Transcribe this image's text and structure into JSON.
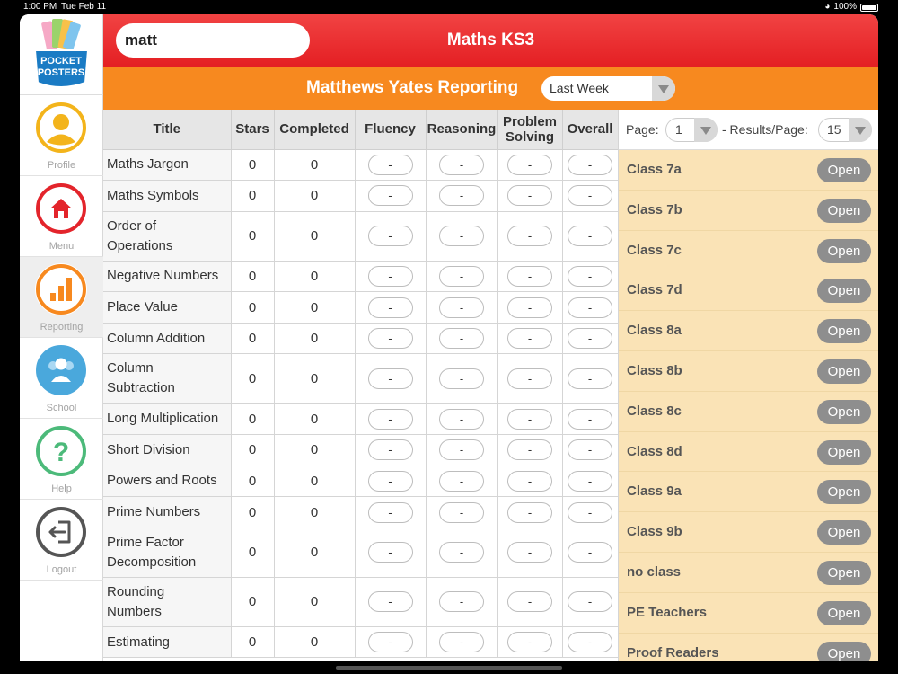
{
  "status_bar": {
    "time": "1:00 PM",
    "date": "Tue Feb 11",
    "battery": "100%"
  },
  "header": {
    "search_value": "matt",
    "title": "Maths KS3"
  },
  "subheader": {
    "title": "Matthews Yates Reporting",
    "period": "Last Week"
  },
  "logo": {
    "line1": "POCKET",
    "line2": "POSTERS"
  },
  "sidebar": {
    "items": [
      {
        "label": "Profile",
        "icon": "profile-icon",
        "color": "#f3b41b"
      },
      {
        "label": "Menu",
        "icon": "home-icon",
        "color": "#e3242b"
      },
      {
        "label": "Reporting",
        "icon": "bar-chart-icon",
        "color": "#f7891f",
        "active": true
      },
      {
        "label": "School",
        "icon": "group-icon",
        "color": "#4aa8dc"
      },
      {
        "label": "Help",
        "icon": "question-icon",
        "color": "#4cba7a"
      },
      {
        "label": "Logout",
        "icon": "logout-icon",
        "color": "#555555"
      }
    ]
  },
  "table": {
    "columns": [
      "Title",
      "Stars",
      "Completed",
      "Fluency",
      "Reasoning",
      "Problem Solving",
      "Overall"
    ],
    "rows": [
      {
        "title": "Maths Jargon",
        "stars": "0",
        "completed": "0",
        "fluency": "-",
        "reasoning": "-",
        "problem_solving": "-",
        "overall": "-"
      },
      {
        "title": "Maths Symbols",
        "stars": "0",
        "completed": "0",
        "fluency": "-",
        "reasoning": "-",
        "problem_solving": "-",
        "overall": "-"
      },
      {
        "title": "Order of Operations",
        "stars": "0",
        "completed": "0",
        "fluency": "-",
        "reasoning": "-",
        "problem_solving": "-",
        "overall": "-"
      },
      {
        "title": "Negative Numbers",
        "stars": "0",
        "completed": "0",
        "fluency": "-",
        "reasoning": "-",
        "problem_solving": "-",
        "overall": "-"
      },
      {
        "title": "Place Value",
        "stars": "0",
        "completed": "0",
        "fluency": "-",
        "reasoning": "-",
        "problem_solving": "-",
        "overall": "-"
      },
      {
        "title": "Column Addition",
        "stars": "0",
        "completed": "0",
        "fluency": "-",
        "reasoning": "-",
        "problem_solving": "-",
        "overall": "-"
      },
      {
        "title": "Column Subtraction",
        "stars": "0",
        "completed": "0",
        "fluency": "-",
        "reasoning": "-",
        "problem_solving": "-",
        "overall": "-"
      },
      {
        "title": "Long Multiplication",
        "stars": "0",
        "completed": "0",
        "fluency": "-",
        "reasoning": "-",
        "problem_solving": "-",
        "overall": "-"
      },
      {
        "title": "Short Division",
        "stars": "0",
        "completed": "0",
        "fluency": "-",
        "reasoning": "-",
        "problem_solving": "-",
        "overall": "-"
      },
      {
        "title": "Powers and Roots",
        "stars": "0",
        "completed": "0",
        "fluency": "-",
        "reasoning": "-",
        "problem_solving": "-",
        "overall": "-"
      },
      {
        "title": "Prime Numbers",
        "stars": "0",
        "completed": "0",
        "fluency": "-",
        "reasoning": "-",
        "problem_solving": "-",
        "overall": "-"
      },
      {
        "title": "Prime Factor Decomposition",
        "stars": "0",
        "completed": "0",
        "fluency": "-",
        "reasoning": "-",
        "problem_solving": "-",
        "overall": "-"
      },
      {
        "title": "Rounding Numbers",
        "stars": "0",
        "completed": "0",
        "fluency": "-",
        "reasoning": "-",
        "problem_solving": "-",
        "overall": "-"
      },
      {
        "title": "Estimating",
        "stars": "0",
        "completed": "0",
        "fluency": "-",
        "reasoning": "-",
        "problem_solving": "-",
        "overall": "-"
      }
    ]
  },
  "pager": {
    "page_label": "Page:",
    "page_value": "1",
    "results_label": "- Results/Page:",
    "results_value": "15"
  },
  "classes": {
    "open_label": "Open",
    "items": [
      "Class 7a",
      "Class 7b",
      "Class 7c",
      "Class 7d",
      "Class 8a",
      "Class 8b",
      "Class 8c",
      "Class 8d",
      "Class 9a",
      "Class 9b",
      "no class",
      "PE Teachers",
      "Proof Readers"
    ]
  }
}
